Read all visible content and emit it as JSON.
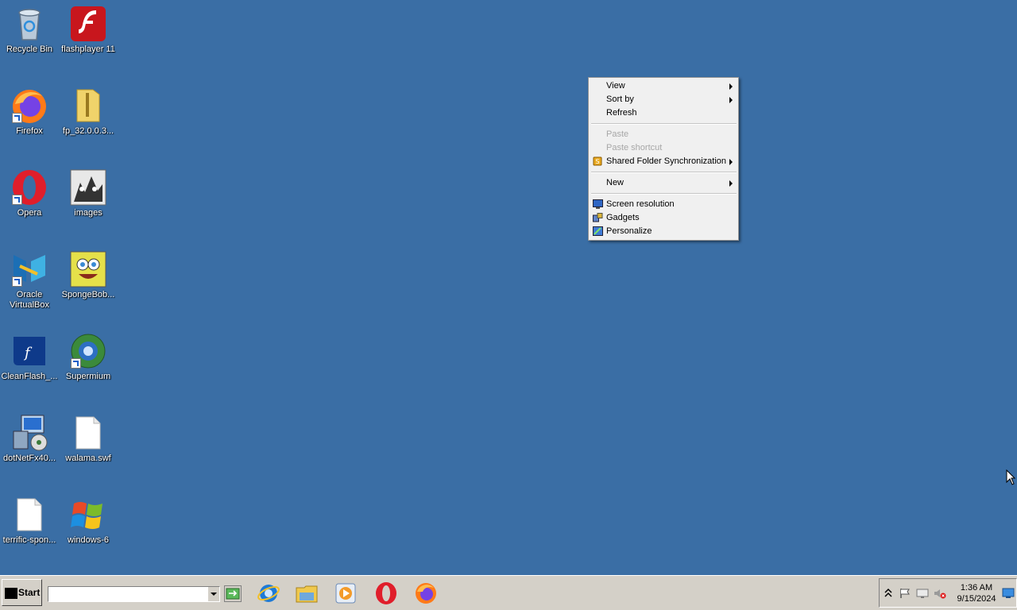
{
  "desktop": {
    "icons": [
      {
        "name": "recycle-bin-icon",
        "label": "Recycle Bin"
      },
      {
        "name": "flash-player-icon",
        "label": "flashplayer 11"
      },
      {
        "name": "firefox-icon",
        "label": "Firefox"
      },
      {
        "name": "folder-icon",
        "label": "fp_32.0.0.3..."
      },
      {
        "name": "opera-icon",
        "label": "Opera"
      },
      {
        "name": "images-icon",
        "label": "images"
      },
      {
        "name": "virtualbox-icon",
        "label": "Oracle VirtualBox"
      },
      {
        "name": "spongebob-icon",
        "label": "SpongeBob..."
      },
      {
        "name": "cleanflash-icon",
        "label": "CleanFlash_..."
      },
      {
        "name": "supermium-icon",
        "label": "Supermium"
      },
      {
        "name": "dotnet-installer-icon",
        "label": "dotNetFx40..."
      },
      {
        "name": "swf-file-icon",
        "label": "walama.swf"
      },
      {
        "name": "file-icon",
        "label": "terrific-spon..."
      },
      {
        "name": "windows-logo-icon",
        "label": "windows-6"
      }
    ]
  },
  "context_menu": {
    "view": "View",
    "sort_by": "Sort by",
    "refresh": "Refresh",
    "paste": "Paste",
    "paste_shortcut": "Paste shortcut",
    "shared_folder_sync": "Shared Folder Synchronization",
    "new": "New",
    "screen_resolution": "Screen resolution",
    "gadgets": "Gadgets",
    "personalize": "Personalize"
  },
  "taskbar": {
    "start_label": "Start",
    "address_value": "",
    "pinned_apps": [
      "internet-explorer-icon",
      "explorer-folder-icon",
      "media-player-icon",
      "opera-icon",
      "firefox-icon"
    ],
    "clock_time": "1:36 AM",
    "clock_date": "9/15/2024"
  },
  "colors": {
    "desktop_background": "#3a6ea5",
    "taskbar_background": "#d4d0c8",
    "menu_background": "#f0f0f0"
  }
}
